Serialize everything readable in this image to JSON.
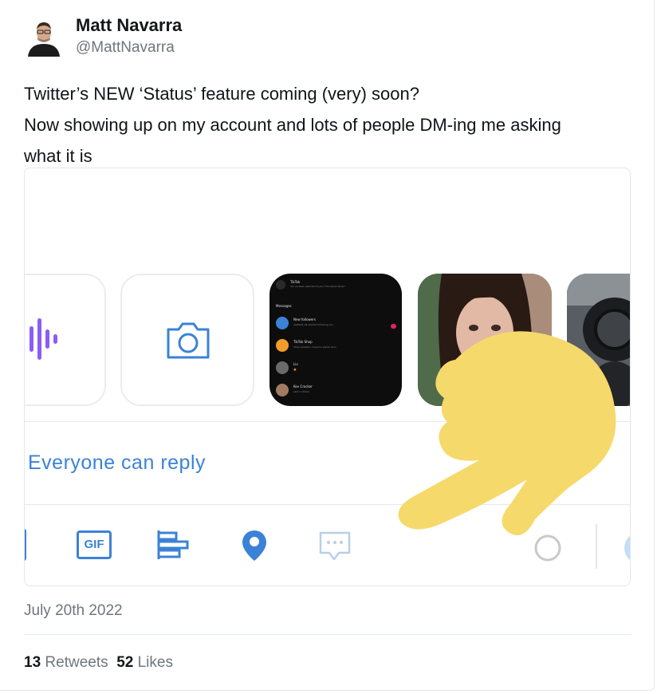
{
  "author": {
    "name": "Matt Navarra",
    "handle": "@MattNavarra"
  },
  "tweet": {
    "lines": [
      "Twitter’s NEW ‘Status’ feature coming (very) soon?",
      "Now showing up on my account and lots of people DM-ing me asking",
      "what it is"
    ],
    "date": "July 20th 2022"
  },
  "stats": {
    "retweets_count": "13",
    "retweets_label": "Retweets",
    "likes_count": "52",
    "likes_label": "Likes"
  },
  "media": {
    "reply_setting": "Everyone can reply",
    "gif_label": "GIF",
    "dm_preview": {
      "header": "Messages",
      "top_title": "TikTok",
      "top_subtitle": "You've been selected to join The Game Show!",
      "rows": [
        {
          "title": "New followers",
          "subtitle": "seatbelt_96 started following you",
          "badge": "2"
        },
        {
          "title": "TikTok Shop",
          "subtitle": "Shop updates: Coupons expire soon",
          "badge": ""
        },
        {
          "title": "Liv",
          "subtitle": "👍",
          "badge": ""
        },
        {
          "title": "Kev Crocker",
          "subtitle": "sent a sticker",
          "badge": ""
        }
      ]
    }
  },
  "colors": {
    "accent": "#3b82d6",
    "audio_purple": "#8b5cf6",
    "pointer_yellow": "#f6d96b",
    "secondary_text": "#6e767d"
  },
  "icons": [
    "audio-waveform-icon",
    "camera-icon",
    "gif-icon",
    "poll-icon",
    "location-pin-icon",
    "chat-bubble-icon",
    "progress-circle-icon",
    "pointing-hand-overlay"
  ]
}
